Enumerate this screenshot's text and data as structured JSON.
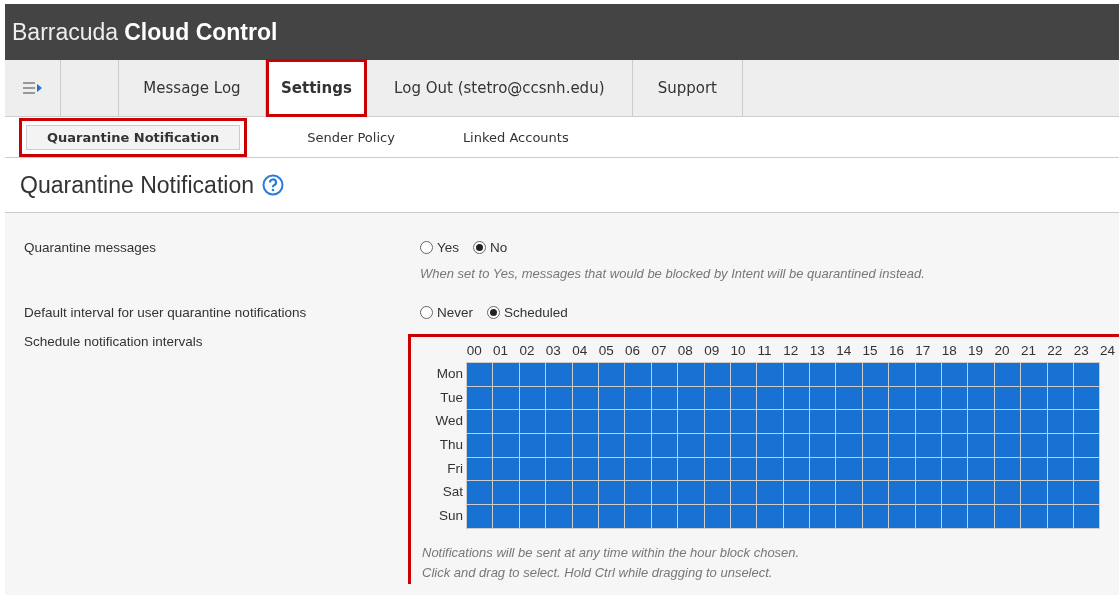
{
  "header": {
    "brand_light": "Barracuda",
    "brand_bold": "Cloud Control"
  },
  "nav": {
    "tabs": [
      {
        "label": "Message Log",
        "selected": false,
        "highlighted": false
      },
      {
        "label": "Settings",
        "selected": true,
        "highlighted": true
      },
      {
        "label": "Log Out (stetro@ccsnh.edu)",
        "selected": false,
        "highlighted": false
      },
      {
        "label": "Support",
        "selected": false,
        "highlighted": false
      }
    ]
  },
  "subnav": {
    "tabs": [
      {
        "label": "Quarantine Notification",
        "selected": true,
        "highlighted": true
      },
      {
        "label": "Sender Policy",
        "selected": false,
        "highlighted": false
      },
      {
        "label": "Linked Accounts",
        "selected": false,
        "highlighted": false
      }
    ]
  },
  "page_title": "Quarantine Notification",
  "settings": [
    {
      "kind": "radio",
      "label": "Quarantine messages",
      "options": [
        {
          "label": "Yes",
          "selected": false
        },
        {
          "label": "No",
          "selected": true
        }
      ],
      "hint": "When set to Yes, messages that would be blocked by Intent will be quarantined instead."
    },
    {
      "kind": "radio",
      "label": "Default interval for user quarantine notifications",
      "options": [
        {
          "label": "Never",
          "selected": false
        },
        {
          "label": "Scheduled",
          "selected": true
        }
      ]
    },
    {
      "kind": "schedule",
      "label": "Schedule notification intervals",
      "highlighted": true,
      "hours": [
        "00",
        "01",
        "02",
        "03",
        "04",
        "05",
        "06",
        "07",
        "08",
        "09",
        "10",
        "11",
        "12",
        "13",
        "14",
        "15",
        "16",
        "17",
        "18",
        "19",
        "20",
        "21",
        "22",
        "23",
        "24"
      ],
      "days": [
        {
          "label": "Mon",
          "selected": [
            true,
            true,
            true,
            true,
            true,
            true,
            true,
            true,
            true,
            true,
            true,
            true,
            true,
            true,
            true,
            true,
            true,
            true,
            true,
            true,
            true,
            true,
            true,
            true
          ]
        },
        {
          "label": "Tue",
          "selected": [
            true,
            true,
            true,
            true,
            true,
            true,
            true,
            true,
            true,
            true,
            true,
            true,
            true,
            true,
            true,
            true,
            true,
            true,
            true,
            true,
            true,
            true,
            true,
            true
          ]
        },
        {
          "label": "Wed",
          "selected": [
            true,
            true,
            true,
            true,
            true,
            true,
            true,
            true,
            true,
            true,
            true,
            true,
            true,
            true,
            true,
            true,
            true,
            true,
            true,
            true,
            true,
            true,
            true,
            true
          ]
        },
        {
          "label": "Thu",
          "selected": [
            true,
            true,
            true,
            true,
            true,
            true,
            true,
            true,
            true,
            true,
            true,
            true,
            true,
            true,
            true,
            true,
            true,
            true,
            true,
            true,
            true,
            true,
            true,
            true
          ]
        },
        {
          "label": "Fri",
          "selected": [
            true,
            true,
            true,
            true,
            true,
            true,
            true,
            true,
            true,
            true,
            true,
            true,
            true,
            true,
            true,
            true,
            true,
            true,
            true,
            true,
            true,
            true,
            true,
            true
          ]
        },
        {
          "label": "Sat",
          "selected": [
            true,
            true,
            true,
            true,
            true,
            true,
            true,
            true,
            true,
            true,
            true,
            true,
            true,
            true,
            true,
            true,
            true,
            true,
            true,
            true,
            true,
            true,
            true,
            true
          ]
        },
        {
          "label": "Sun",
          "selected": [
            true,
            true,
            true,
            true,
            true,
            true,
            true,
            true,
            true,
            true,
            true,
            true,
            true,
            true,
            true,
            true,
            true,
            true,
            true,
            true,
            true,
            true,
            true,
            true
          ]
        }
      ],
      "notes": [
        "Notifications will be sent at any time within the hour block chosen.",
        "Click and drag to select. Hold Ctrl while dragging to unselect."
      ]
    }
  ]
}
